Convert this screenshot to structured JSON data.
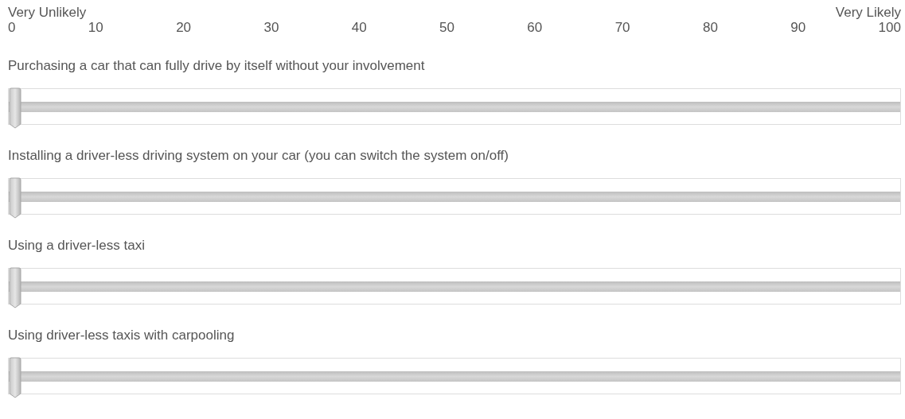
{
  "scale": {
    "min_label": "Very Unlikely",
    "max_label": "Very Likely",
    "ticks": [
      "0",
      "10",
      "20",
      "30",
      "40",
      "50",
      "60",
      "70",
      "80",
      "90",
      "100"
    ]
  },
  "questions": [
    {
      "text": "Purchasing a car that can fully drive by itself without your involvement",
      "level": 0
    },
    {
      "text": "Installing a driver-less driving system on your car (you can switch the system on/off)",
      "level": 0
    },
    {
      "text": "Using a driver-less taxi",
      "level": 0
    },
    {
      "text": "Using driver-less taxis with carpooling",
      "level": 0
    }
  ]
}
